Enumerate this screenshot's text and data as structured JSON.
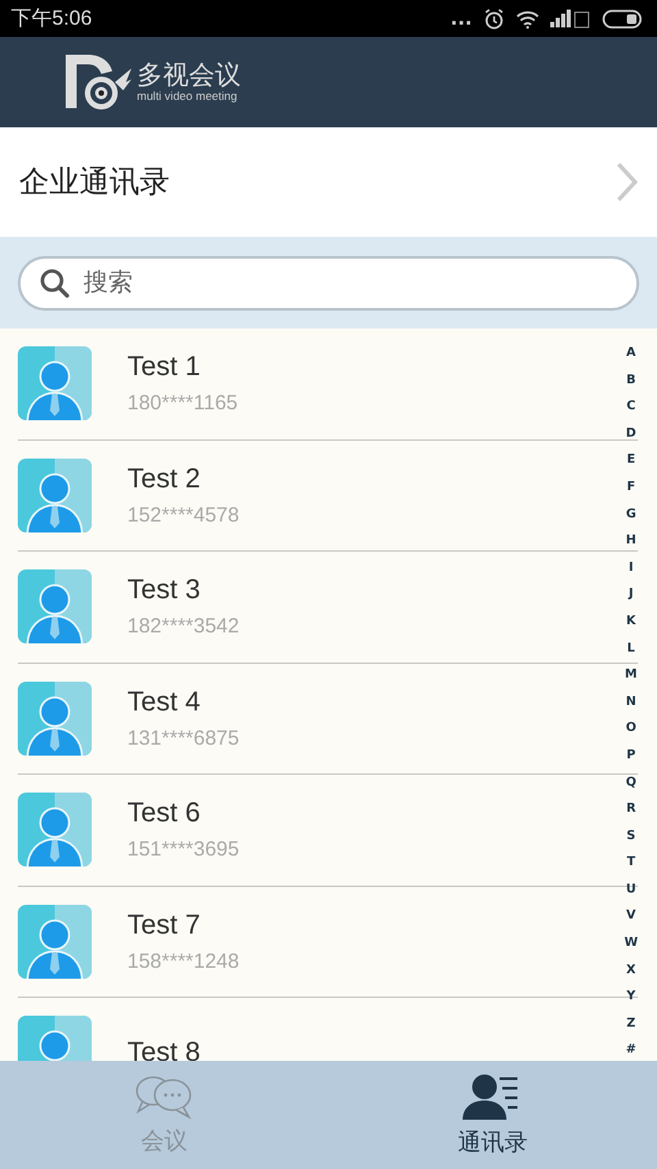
{
  "status_bar": {
    "time": "下午5:06",
    "dots": "..."
  },
  "header": {
    "logo_title": "多视会议",
    "logo_subtitle": "multi video meeting"
  },
  "section": {
    "title": "企业通讯录"
  },
  "search": {
    "placeholder": "搜索"
  },
  "contacts": [
    {
      "name": "Test 1",
      "phone": "180****1165"
    },
    {
      "name": "Test 2",
      "phone": "152****4578"
    },
    {
      "name": "Test 3",
      "phone": "182****3542"
    },
    {
      "name": "Test 4",
      "phone": "131****6875"
    },
    {
      "name": "Test 6",
      "phone": "151****3695"
    },
    {
      "name": "Test 7",
      "phone": "158****1248"
    },
    {
      "name": "Test 8"
    }
  ],
  "index_letters": [
    "A",
    "B",
    "C",
    "D",
    "E",
    "F",
    "G",
    "H",
    "I",
    "J",
    "K",
    "L",
    "M",
    "N",
    "O",
    "P",
    "Q",
    "R",
    "S",
    "T",
    "U",
    "V",
    "W",
    "X",
    "Y",
    "Z",
    "#"
  ],
  "tabs": [
    {
      "label": "会议",
      "kind": "meetings",
      "selected": false
    },
    {
      "label": "通讯录",
      "kind": "contacts",
      "selected": true
    }
  ]
}
